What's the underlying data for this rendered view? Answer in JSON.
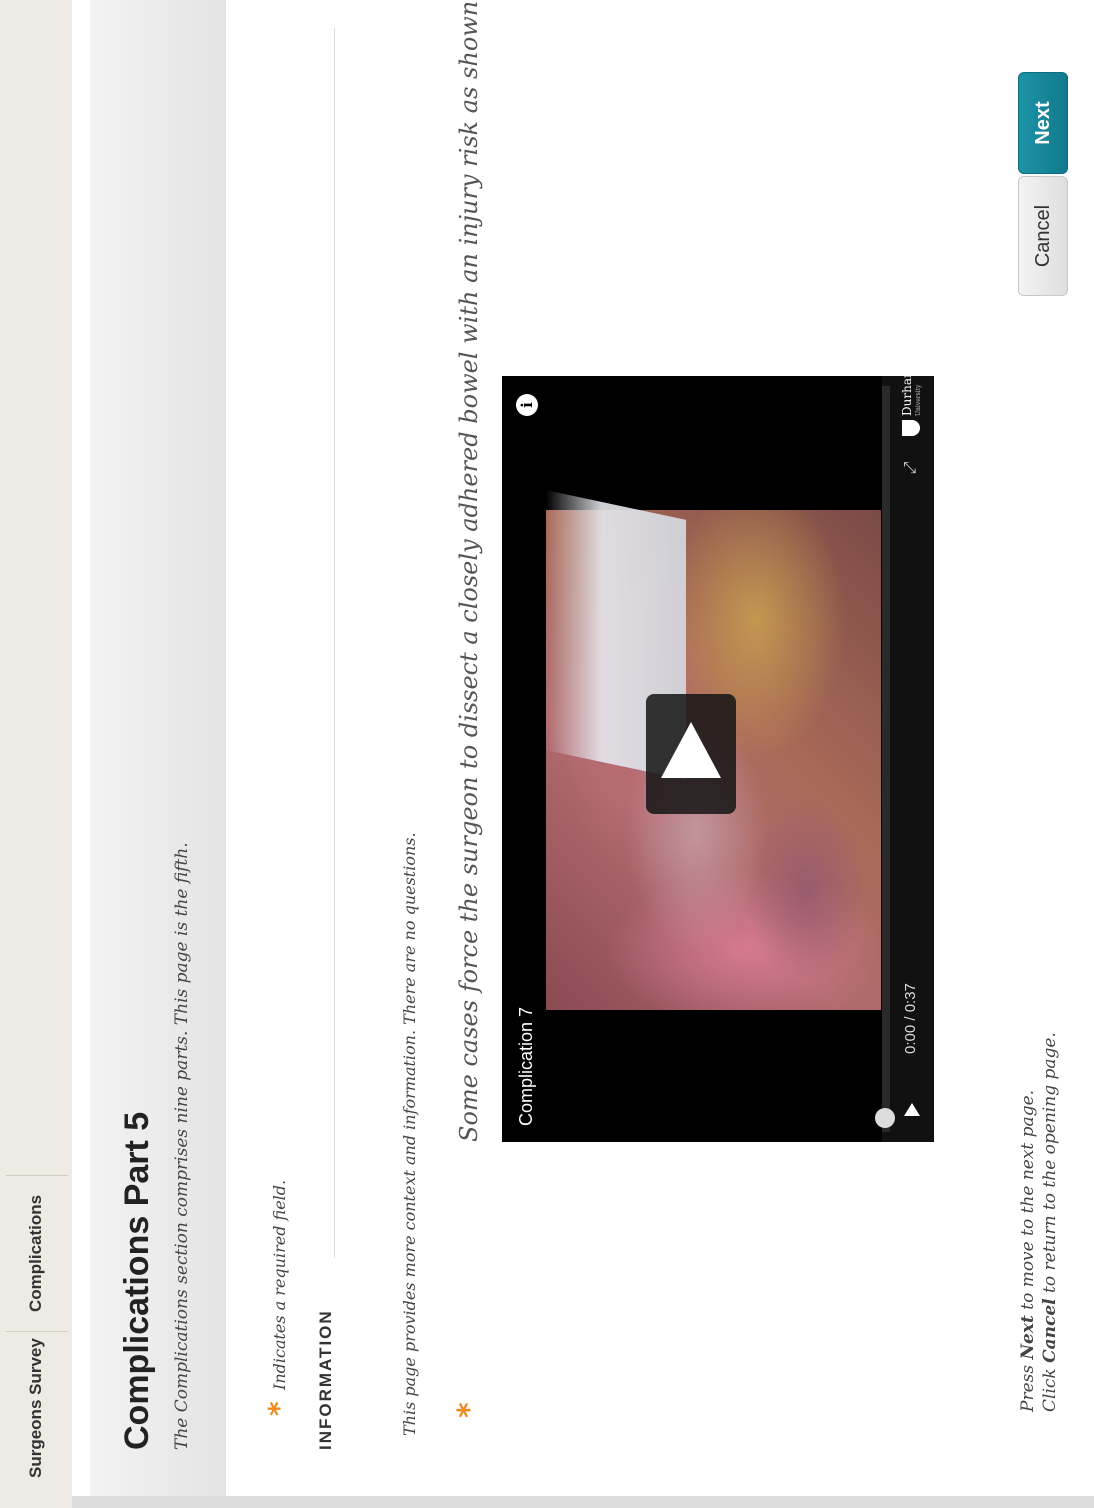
{
  "breadcrumb": [
    "Surgeons Survey",
    "Complications"
  ],
  "page": {
    "title": "Complications Part 5",
    "subtitle": "The Complications section comprises nine parts. This page is the fifth."
  },
  "required_note": "Indicates a required field.",
  "section_heading": "INFORMATION",
  "info_text": "This page provides more context and information. There are no questions.",
  "question": "Some cases force the surgeon to dissect a closely adhered bowel with an injury risk as shown in this clip:",
  "video": {
    "label": "Complication 7",
    "current_time": "0:00",
    "duration": "/ 0:37",
    "progress": 0,
    "logo_name": "Durham",
    "logo_sub": "University"
  },
  "footer": {
    "line1_pre": "Press ",
    "line1_bold": "Next",
    "line1_post": " to move to the next page.",
    "line2_pre": "Click ",
    "line2_bold": "Cancel",
    "line2_post": " to return to the opening page."
  },
  "buttons": {
    "cancel": "Cancel",
    "next": "Next"
  },
  "colors": {
    "accent": "#117a8c",
    "required_star": "#f08a1c"
  }
}
